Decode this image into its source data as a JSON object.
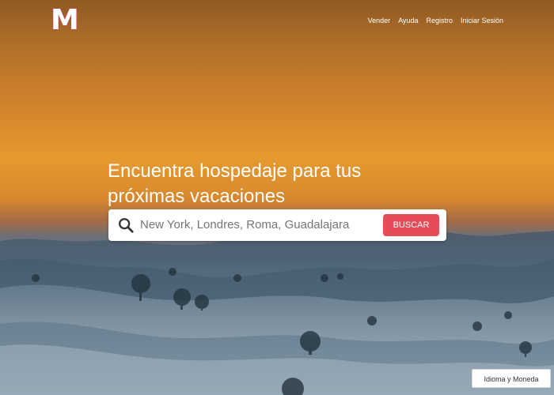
{
  "logo": {
    "text": "M"
  },
  "nav": {
    "items": [
      {
        "label": "Vender"
      },
      {
        "label": "Ayuda"
      },
      {
        "label": "Registro"
      },
      {
        "label": "Iniciar Sesión"
      }
    ]
  },
  "hero": {
    "headline": "Encuentra hospedaje para tus próximas vacaciones"
  },
  "search": {
    "placeholder": "New York, Londres, Roma, Guadalajara",
    "button_label": "BUSCAR",
    "icon": "search-icon"
  },
  "footer": {
    "language_button": "Idioma y Moneda"
  },
  "colors": {
    "accent": "#e64b58",
    "logo_outline": "#c6474b",
    "sky_orange": "#e59a2f",
    "fog_blue": "#8ea7b7"
  }
}
